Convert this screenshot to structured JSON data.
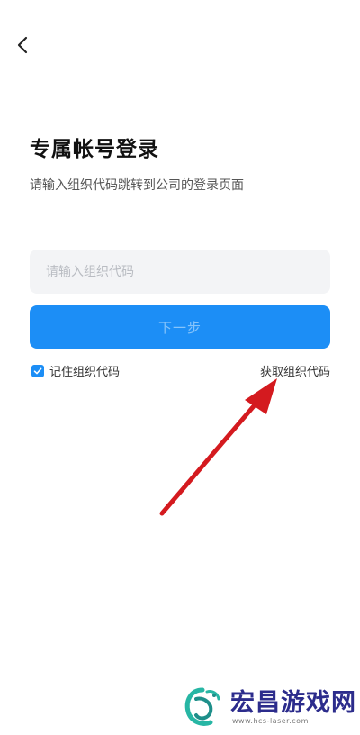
{
  "header": {
    "back_icon": "chevron-left-icon"
  },
  "login": {
    "title": "专属帐号登录",
    "subtitle": "请输入组织代码跳转到公司的登录页面",
    "org_code_input": {
      "value": "",
      "placeholder": "请输入组织代码"
    },
    "next_button_label": "下一步",
    "remember": {
      "checked": true,
      "label": "记住组织代码"
    },
    "get_code_link": "获取组织代码"
  },
  "watermark": {
    "name": "宏昌游戏网",
    "url": "www.hcs-laser.com"
  },
  "colors": {
    "primary": "#1c8ef6",
    "button_text_disabled": "#86c4fb",
    "input_background": "#f3f4f6",
    "annotation_arrow": "#d41a1f",
    "watermark_text": "#2c2c8c"
  }
}
